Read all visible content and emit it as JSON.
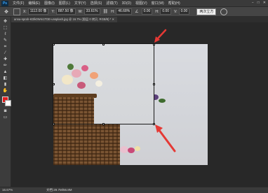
{
  "app": {
    "logo": "Ps"
  },
  "menu": {
    "items": [
      "文件(F)",
      "编辑(E)",
      "图像(I)",
      "图层(L)",
      "文字(Y)",
      "选择(S)",
      "滤镜(T)",
      "3D(D)",
      "视图(V)",
      "窗口(W)",
      "帮助(H)"
    ]
  },
  "window_controls": {
    "minimize": "−",
    "maximize": "□",
    "close": "✕"
  },
  "options": {
    "x_label": "X:",
    "x_value": "1112.00 像",
    "y_label": "Y:",
    "y_value": "887.50 像",
    "w_label": "W:",
    "w_value": "33.61%",
    "h_label": "H:",
    "h_value": "46.68%",
    "angle_value": "0.00",
    "h_skew_label": "H:",
    "h_skew_value": "0.00",
    "v_skew_label": "V:",
    "v_skew_value": "0.00",
    "interpolation": "两次立方"
  },
  "document": {
    "tab_label": "anna-sprah-KDlk0Wm1TDE-unsplash.jpg @ 16.7% (图层 0 拷贝, RGB/8) * ✕"
  },
  "status": {
    "zoom": "16.67%",
    "doc_info": "文档:29.7M/56.8M"
  },
  "icons": {
    "move": "move-icon",
    "marquee": "marquee-icon",
    "lasso": "lasso-icon",
    "quick-select": "quick-select-icon",
    "crop": "crop-icon",
    "eyedropper": "eyedropper-icon",
    "healing": "healing-brush-icon",
    "brush": "brush-icon",
    "stamp": "clone-stamp-icon",
    "history-brush": "history-brush-icon",
    "eraser": "eraser-icon",
    "gradient": "gradient-icon",
    "blur": "blur-icon",
    "dodge": "dodge-icon",
    "pen": "pen-icon",
    "type": "type-icon",
    "path-select": "path-selection-icon",
    "shape": "shape-icon",
    "hand": "hand-icon",
    "zoom": "zoom-icon"
  },
  "colors": {
    "foreground": "#e21c1c",
    "background": "#ffffff",
    "arrow": "#e53935"
  }
}
